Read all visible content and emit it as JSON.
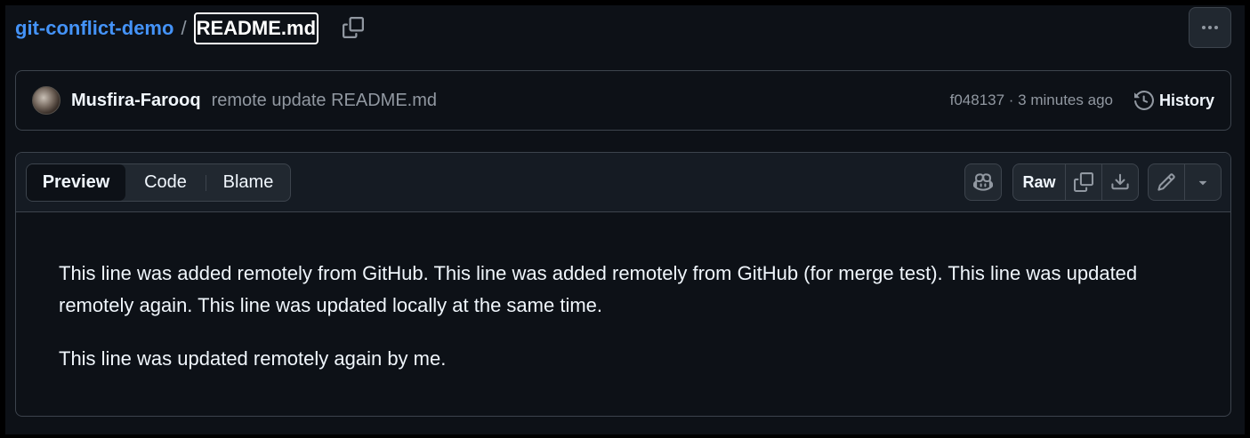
{
  "breadcrumb": {
    "repo": "git-conflict-demo",
    "separator": "/",
    "file": "README.md"
  },
  "commit": {
    "author": "Musfira-Farooq",
    "message": "remote update README.md",
    "meta": "f048137 · 3 minutes ago",
    "history_label": "History"
  },
  "file_header": {
    "tabs": [
      "Preview",
      "Code",
      "Blame"
    ],
    "raw_label": "Raw"
  },
  "content": {
    "paragraphs": [
      "This line was added remotely from GitHub. This line was added remotely from GitHub (for merge test). This line was updated remotely again. This line was updated locally at the same time.",
      "This line was updated remotely again by me."
    ]
  },
  "icons": {
    "copy": "copy-icon",
    "kebab": "kebab-horizontal-icon",
    "history": "history-icon",
    "copilot": "copilot-icon",
    "download": "download-icon",
    "pencil": "pencil-icon",
    "caret": "triangle-down-icon"
  },
  "colors": {
    "background": "#0d1117",
    "link": "#4493f8",
    "border": "#3d444d",
    "muted": "#9198a1"
  }
}
